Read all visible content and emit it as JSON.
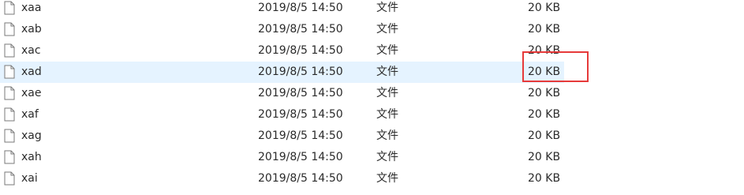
{
  "files": [
    {
      "name": "xaa",
      "modified": "2019/8/5 14:50",
      "type": "文件",
      "size": "20 KB"
    },
    {
      "name": "xab",
      "modified": "2019/8/5 14:50",
      "type": "文件",
      "size": "20 KB"
    },
    {
      "name": "xac",
      "modified": "2019/8/5 14:50",
      "type": "文件",
      "size": "20 KB"
    },
    {
      "name": "xad",
      "modified": "2019/8/5 14:50",
      "type": "文件",
      "size": "20 KB"
    },
    {
      "name": "xae",
      "modified": "2019/8/5 14:50",
      "type": "文件",
      "size": "20 KB"
    },
    {
      "name": "xaf",
      "modified": "2019/8/5 14:50",
      "type": "文件",
      "size": "20 KB"
    },
    {
      "name": "xag",
      "modified": "2019/8/5 14:50",
      "type": "文件",
      "size": "20 KB"
    },
    {
      "name": "xah",
      "modified": "2019/8/5 14:50",
      "type": "文件",
      "size": "20 KB"
    },
    {
      "name": "xai",
      "modified": "2019/8/5 14:50",
      "type": "文件",
      "size": "20 KB"
    }
  ],
  "selected_index": 3,
  "icon": "file-icon",
  "colors": {
    "selection": "#e5f3ff",
    "annotation": "#e63a3a"
  }
}
